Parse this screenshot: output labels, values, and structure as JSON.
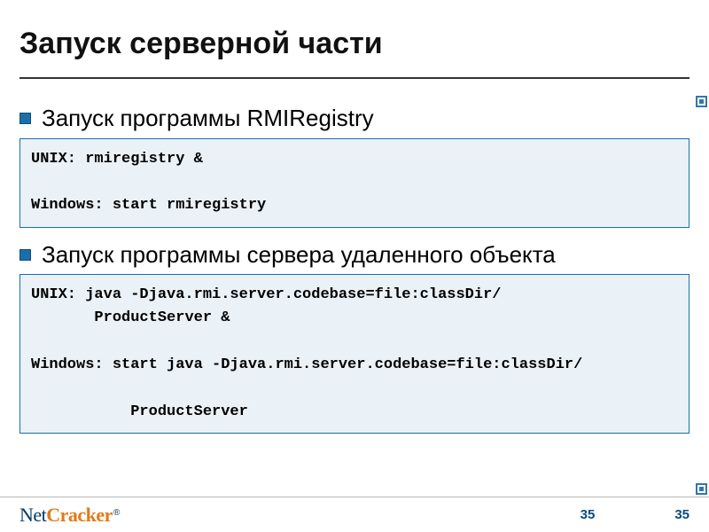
{
  "title": "Запуск серверной части",
  "bullets": [
    {
      "text": "Запуск программы RMIRegistry"
    },
    {
      "text": "Запуск программы сервера удаленного объекта"
    }
  ],
  "code_boxes": [
    "UNIX: rmiregistry &\n\nWindows: start rmiregistry",
    "UNIX: java -Djava.rmi.server.codebase=file:classDir/\n       ProductServer &\n\nWindows: start java -Djava.rmi.server.codebase=file:classDir/\n\n           ProductServer"
  ],
  "brand": {
    "net": "Net",
    "cracker": "Cracker",
    "reg": "®"
  },
  "page": {
    "left": "35",
    "right": "35"
  }
}
